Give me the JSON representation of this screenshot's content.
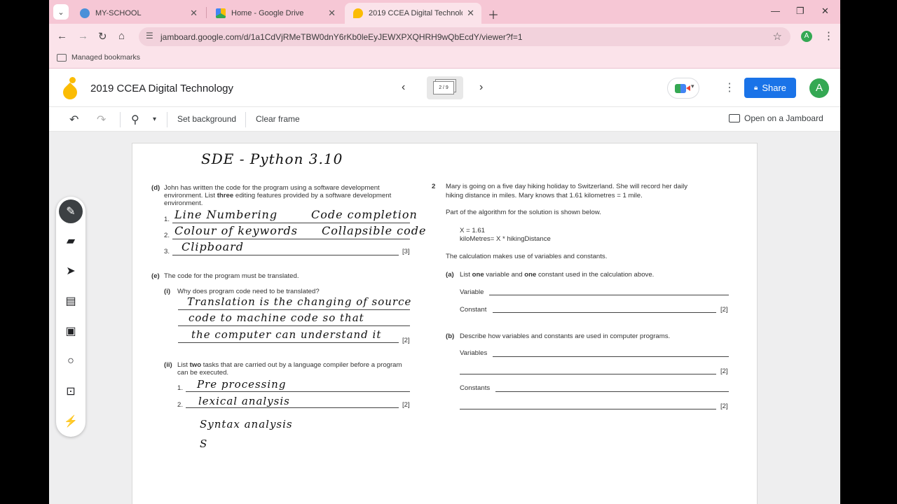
{
  "browser": {
    "tabs": [
      {
        "label": "MY-SCHOOL",
        "active": false
      },
      {
        "label": "Home - Google Drive",
        "active": false
      },
      {
        "label": "2019 CCEA Digital Technology",
        "active": true
      }
    ],
    "url": "jamboard.google.com/d/1a1CdVjRMeTBW0dnY6rKb0leEyJEWXPXQHRH9wQbEcdY/viewer?f=1",
    "profile_initial": "A",
    "bookmarks": [
      "Managed bookmarks"
    ]
  },
  "app": {
    "title": "2019 CCEA Digital Technology",
    "frame_indicator": "2 / 9",
    "share_label": "Share",
    "avatar_initial": "A",
    "accent": "#1a73e8",
    "avatar_color": "#34a853"
  },
  "toolbar": {
    "set_background": "Set background",
    "clear_frame": "Clear frame",
    "open_on_jamboard": "Open on a Jamboard"
  },
  "palette": [
    "pen-icon",
    "eraser-icon",
    "select-icon",
    "sticky-note-icon",
    "image-icon",
    "circle-icon",
    "text-box-icon",
    "laser-icon"
  ],
  "worksheet": {
    "heading_note": "SDE - Python 3.10",
    "q_d": {
      "label": "(d)",
      "line1": "John has written the code for the program using a software development",
      "line2_a": "environment. List ",
      "line2_b": "three",
      "line2_c": " editing features provided by a software development",
      "line3": "environment.",
      "items": [
        "1.",
        "2.",
        "3."
      ],
      "marks": "[3]",
      "answers": [
        "Line Numbering",
        "Code completion",
        "Colour of keywords",
        "Collapsible code",
        "Clipboard"
      ]
    },
    "q_e": {
      "label": "(e)",
      "text": "The code for the program must be translated.",
      "i_label": "(i)",
      "i_text": "Why does program code need to be translated?",
      "i_marks": "[2]",
      "i_answers": [
        "Translation is the changing of source",
        "code to machine code so that",
        "the computer can understand it"
      ],
      "ii_label": "(ii)",
      "ii_text_a": "List ",
      "ii_text_b": "two",
      "ii_text_c": " tasks that are carried out by a language compiler before a program",
      "ii_text2": "can be executed.",
      "ii_items": [
        "1.",
        "2."
      ],
      "ii_marks": "[2]",
      "ii_answers": [
        "Pre processing",
        "lexical analysis",
        "Syntax analysis",
        "S"
      ]
    },
    "q2": {
      "number": "2",
      "line1": "Mary is going on a five day hiking holiday to Switzerland. She will record her daily",
      "line2": "hiking distance in miles. Mary knows that 1.61 kilometres = 1 mile.",
      "part": "Part of the algorithm for the solution is shown below.",
      "code1": "X = 1.61",
      "code2": "kiloMetres= X * hikingDistance",
      "calc": "The calculation makes use of variables and constants.",
      "a_label": "(a)",
      "a_text_a": "List ",
      "a_text_b": "one",
      "a_text_c": " variable and ",
      "a_text_d": "one",
      "a_text_e": " constant used in the calculation above.",
      "variable": "Variable",
      "constant": "Constant",
      "a_marks": "[2]",
      "b_label": "(b)",
      "b_text": "Describe how variables and constants are used in computer programs.",
      "variables": "Variables",
      "constants": "Constants",
      "b_marks1": "[2]",
      "b_marks2": "[2]"
    }
  }
}
